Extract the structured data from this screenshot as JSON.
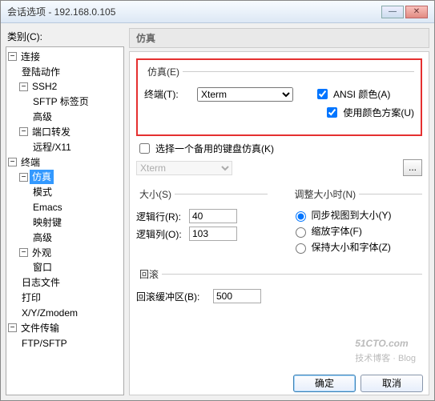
{
  "title": "会话选项 - 192.168.0.105",
  "category_label": "类别(C):",
  "tree": {
    "conn": "连接",
    "login": "登陆动作",
    "ssh2": "SSH2",
    "sftp_tab": "SFTP 标签页",
    "advanced1": "高级",
    "portfwd": "端口转发",
    "remote_x11": "远程/X11",
    "terminal": "终端",
    "emulation": "仿真",
    "modes": "模式",
    "emacs": "Emacs",
    "mapped": "映射键",
    "advanced2": "高级",
    "appearance": "外观",
    "window": "窗口",
    "logfile": "日志文件",
    "print": "打印",
    "xyz": "X/Y/Zmodem",
    "filetrans": "文件传输",
    "ftpsftp": "FTP/SFTP"
  },
  "pane_title": "仿真",
  "emu": {
    "legend": "仿真(E)",
    "terminal_label": "终端(T):",
    "terminal_value": "Xterm",
    "ansi_color": "ANSI 颜色(A)",
    "use_color_scheme": "使用颜色方案(U)",
    "select_alt_kb": "选择一个备用的键盘仿真(K)",
    "alt_kb_value": "Xterm"
  },
  "size": {
    "legend": "大小(S)",
    "rows_label": "逻辑行(R):",
    "rows_value": "40",
    "cols_label": "逻辑列(O):",
    "cols_value": "103"
  },
  "resize": {
    "legend": "调整大小时(N)",
    "opt_sync": "同步视图到大小(Y)",
    "opt_scale": "缩放字体(F)",
    "opt_keep": "保持大小和字体(Z)"
  },
  "scroll": {
    "legend": "回滚",
    "buffer_label": "回滚缓冲区(B):",
    "buffer_value": "500"
  },
  "buttons": {
    "ok": "确定",
    "cancel": "取消"
  },
  "watermark": {
    "brand": "51CTO.com",
    "sub": "技术博客 · Blog"
  },
  "glyph": {
    "minus": "−",
    "ellipsis": "..."
  }
}
